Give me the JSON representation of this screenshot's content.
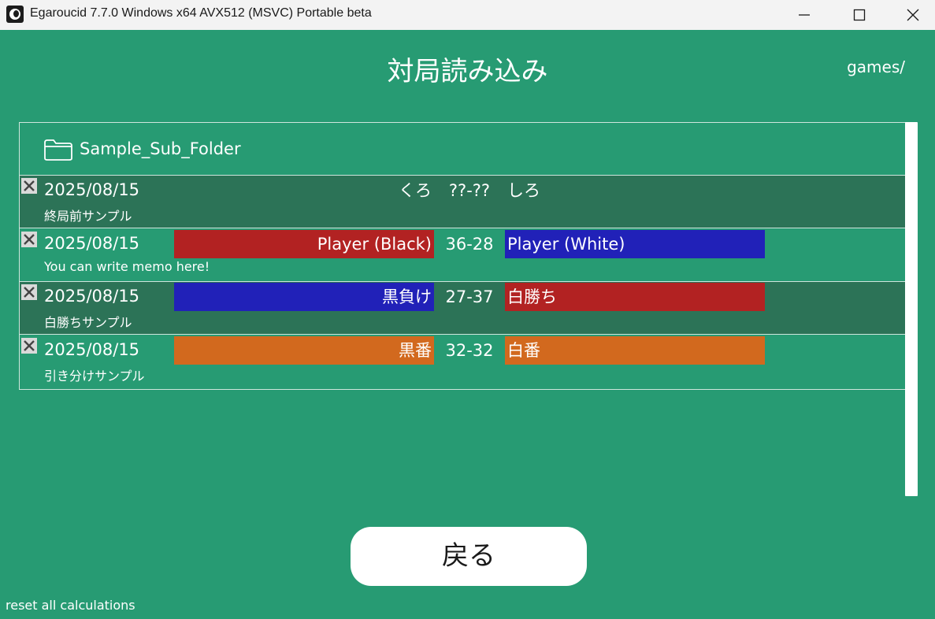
{
  "window": {
    "title": "Egaroucid 7.7.0 Windows x64 AVX512 (MSVC) Portable beta"
  },
  "header": {
    "title": "対局読み込み",
    "path": "games/"
  },
  "folder": {
    "name": "Sample_Sub_Folder",
    "icon": "folder-icon"
  },
  "games": [
    {
      "date": "2025/08/15",
      "black": "くろ",
      "score": "??-??",
      "white": "しろ",
      "memo": "終局前サンプル",
      "black_color": "",
      "white_color": ""
    },
    {
      "date": "2025/08/15",
      "black": "Player (Black)",
      "score": "36-28",
      "white": "Player (White)",
      "memo": "You can write memo here!",
      "black_color": "#b22222",
      "white_color": "#2121b8"
    },
    {
      "date": "2025/08/15",
      "black": "黒負け",
      "score": "27-37",
      "white": "白勝ち",
      "memo": "白勝ちサンプル",
      "black_color": "#2121b8",
      "white_color": "#b22222"
    },
    {
      "date": "2025/08/15",
      "black": "黒番",
      "score": "32-32",
      "white": "白番",
      "memo": "引き分けサンプル",
      "black_color": "#d2691e",
      "white_color": "#d2691e"
    }
  ],
  "buttons": {
    "back": "戻る",
    "reset": "reset all calculations"
  },
  "colors": {
    "background": "#279b73",
    "row_dark": "#2c7357",
    "win": "#b22222",
    "lose": "#2121b8",
    "draw": "#d2691e"
  }
}
